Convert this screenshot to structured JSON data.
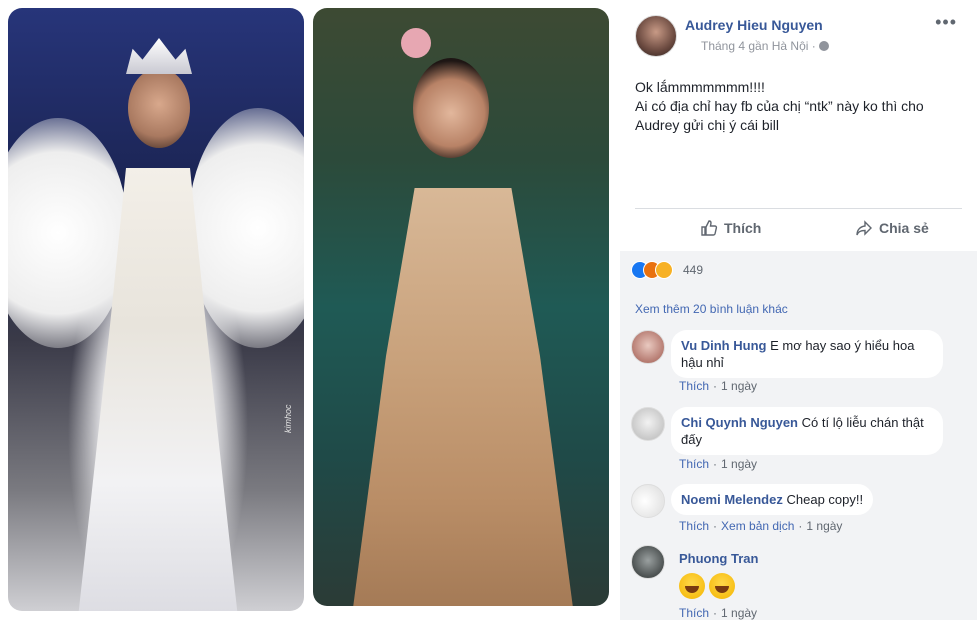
{
  "post": {
    "author": "Audrey Hieu Nguyen",
    "meta": "Tháng 4 gần Hà Nội ·",
    "text_lines": [
      "Ok lắmmmmmmm!!!!",
      "Ai có địa chỉ hay fb của chị “ntk” này ko thì cho",
      "Audrey gửi chị ý cái bill"
    ],
    "actions": {
      "like": "Thích",
      "share": "Chia sẻ"
    },
    "reaction_count": "449",
    "more_comments": "Xem thêm 20 bình luận khác"
  },
  "photos": {
    "left_watermark": "kimhoc"
  },
  "comments": [
    {
      "name": "Vu Dinh Hung",
      "text": "E mơ hay sao ý hiểu hoa hậu nhỉ",
      "like": "Thích",
      "time": "1 ngày"
    },
    {
      "name": "Chi Quynh Nguyen",
      "text": "Có tí lộ liễu chán thật đấy",
      "like": "Thích",
      "time": "1 ngày"
    },
    {
      "name": "Noemi Melendez",
      "text": "Cheap copy!!",
      "like": "Thích",
      "translate": "Xem bản dịch",
      "time": "1 ngày"
    },
    {
      "name": "Phuong Tran",
      "text": "",
      "like": "Thích",
      "time": "1 ngày"
    }
  ],
  "colors": {
    "link": "#385898",
    "blue": "#4267b2",
    "muted": "#606770"
  }
}
